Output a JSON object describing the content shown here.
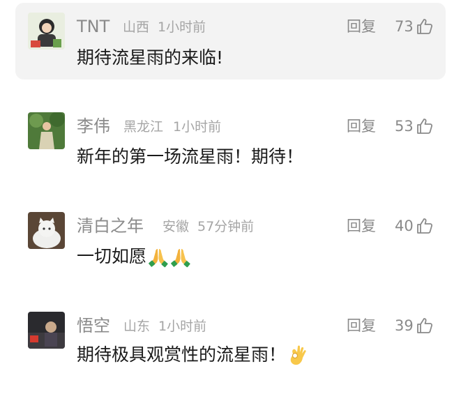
{
  "comments": [
    {
      "name": "TNT",
      "location": "山西",
      "time": "1小时前",
      "reply_label": "回复",
      "likes": "73",
      "text": "期待流星雨的来临!",
      "highlighted": true
    },
    {
      "name": "李伟",
      "location": "黑龙江",
      "time": "1小时前",
      "reply_label": "回复",
      "likes": "53",
      "text": "新年的第一场流星雨！期待！",
      "highlighted": false
    },
    {
      "name": "清白之年",
      "location": "安徽",
      "time": "57分钟前",
      "reply_label": "回复",
      "likes": "40",
      "text": "一切如愿",
      "emoji": "praying-hands-icon x2",
      "highlighted": false
    },
    {
      "name": "悟空",
      "location": "山东",
      "time": "1小时前",
      "reply_label": "回复",
      "likes": "39",
      "text": "期待极具观赏性的流星雨！",
      "emoji": "ok-hand-icon",
      "highlighted": false
    }
  ],
  "colors": {
    "name": "#8a8a8a",
    "meta": "#a5a5a5",
    "text": "#1a1a1a",
    "highlight_bg": "#f3f3f3"
  }
}
